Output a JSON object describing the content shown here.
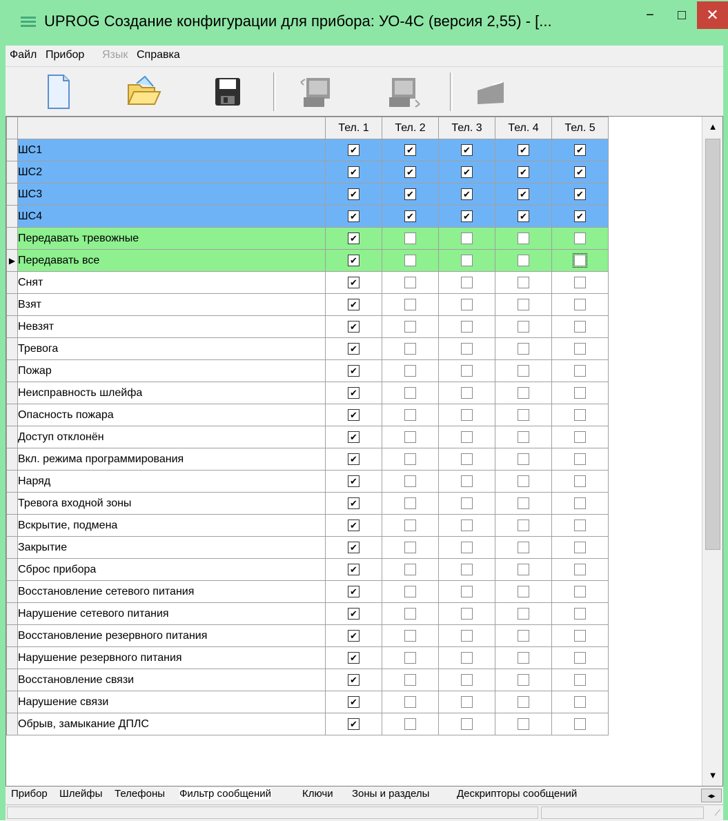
{
  "window": {
    "title": "UPROG  Создание конфигурации для прибора: УО-4С (версия  2,55) - [...",
    "minimize_glyph": "−",
    "maximize_glyph": "□",
    "close_glyph": "✕"
  },
  "menu": {
    "file": "Файл",
    "device": "Прибор",
    "language": "Язык",
    "help": "Справка"
  },
  "toolbar": {
    "icons": [
      "new-document-icon",
      "open-folder-icon",
      "save-floppy-icon",
      "read-from-device-icon",
      "write-to-device-icon",
      "device-icon"
    ]
  },
  "grid": {
    "columns": [
      "Тел. 1",
      "Тел. 2",
      "Тел. 3",
      "Тел. 4",
      "Тел. 5"
    ],
    "rows": [
      {
        "label": "ШС1",
        "style": "blue",
        "checks": [
          true,
          true,
          true,
          true,
          true
        ]
      },
      {
        "label": "ШС2",
        "style": "blue",
        "checks": [
          true,
          true,
          true,
          true,
          true
        ]
      },
      {
        "label": "ШС3",
        "style": "blue",
        "checks": [
          true,
          true,
          true,
          true,
          true
        ]
      },
      {
        "label": "ШС4",
        "style": "blue",
        "checks": [
          true,
          true,
          true,
          true,
          true
        ]
      },
      {
        "label": "Передавать тревожные",
        "style": "green",
        "checks": [
          true,
          false,
          false,
          false,
          false
        ]
      },
      {
        "label": "Передавать все",
        "style": "green",
        "checks": [
          true,
          false,
          false,
          false,
          false
        ],
        "current": true,
        "focus_col": 4
      },
      {
        "label": "Снят",
        "style": "",
        "checks": [
          true,
          false,
          false,
          false,
          false
        ]
      },
      {
        "label": "Взят",
        "style": "",
        "checks": [
          true,
          false,
          false,
          false,
          false
        ]
      },
      {
        "label": "Невзят",
        "style": "",
        "checks": [
          true,
          false,
          false,
          false,
          false
        ]
      },
      {
        "label": "Тревога",
        "style": "",
        "checks": [
          true,
          false,
          false,
          false,
          false
        ]
      },
      {
        "label": "Пожар",
        "style": "",
        "checks": [
          true,
          false,
          false,
          false,
          false
        ]
      },
      {
        "label": "Неисправность шлейфа",
        "style": "",
        "checks": [
          true,
          false,
          false,
          false,
          false
        ]
      },
      {
        "label": "Опасность пожара",
        "style": "",
        "checks": [
          true,
          false,
          false,
          false,
          false
        ]
      },
      {
        "label": "Доступ отклонён",
        "style": "",
        "checks": [
          true,
          false,
          false,
          false,
          false
        ]
      },
      {
        "label": "Вкл. режима программирования",
        "style": "",
        "checks": [
          true,
          false,
          false,
          false,
          false
        ]
      },
      {
        "label": "Наряд",
        "style": "",
        "checks": [
          true,
          false,
          false,
          false,
          false
        ]
      },
      {
        "label": "Тревога входной зоны",
        "style": "",
        "checks": [
          true,
          false,
          false,
          false,
          false
        ]
      },
      {
        "label": "Вскрытие, подмена",
        "style": "",
        "checks": [
          true,
          false,
          false,
          false,
          false
        ]
      },
      {
        "label": "Закрытие",
        "style": "",
        "checks": [
          true,
          false,
          false,
          false,
          false
        ]
      },
      {
        "label": "Сброс прибора",
        "style": "",
        "checks": [
          true,
          false,
          false,
          false,
          false
        ]
      },
      {
        "label": "Восстановление сетевого питания",
        "style": "",
        "checks": [
          true,
          false,
          false,
          false,
          false
        ]
      },
      {
        "label": "Нарушение сетевого питания",
        "style": "",
        "checks": [
          true,
          false,
          false,
          false,
          false
        ]
      },
      {
        "label": "Восстановление резервного питания",
        "style": "",
        "checks": [
          true,
          false,
          false,
          false,
          false
        ]
      },
      {
        "label": "Нарушение резервного питания",
        "style": "",
        "checks": [
          true,
          false,
          false,
          false,
          false
        ]
      },
      {
        "label": "Восстановление связи",
        "style": "",
        "checks": [
          true,
          false,
          false,
          false,
          false
        ]
      },
      {
        "label": "Нарушение связи",
        "style": "",
        "checks": [
          true,
          false,
          false,
          false,
          false
        ]
      },
      {
        "label": "Обрыв, замыкание ДПЛС",
        "style": "",
        "checks": [
          true,
          false,
          false,
          false,
          false
        ]
      }
    ]
  },
  "scrollbar": {
    "up": "▲",
    "down": "▼"
  },
  "tabs": [
    {
      "label": "Прибор",
      "active": false
    },
    {
      "label": "Шлейфы",
      "active": false
    },
    {
      "label": "Телефоны",
      "active": false
    },
    {
      "label": "Фильтр сообщений",
      "active": true
    },
    {
      "label": "Ключи",
      "active": false
    },
    {
      "label": "Зоны и разделы",
      "active": false
    },
    {
      "label": "Дескрипторы сообщений",
      "active": false
    }
  ],
  "tab_nav": "◂▸",
  "colors": {
    "blue_row": "#6fb3f7",
    "green_row": "#8ef08f",
    "title_bg": "#8ee6a6",
    "close": "#c7443a"
  }
}
